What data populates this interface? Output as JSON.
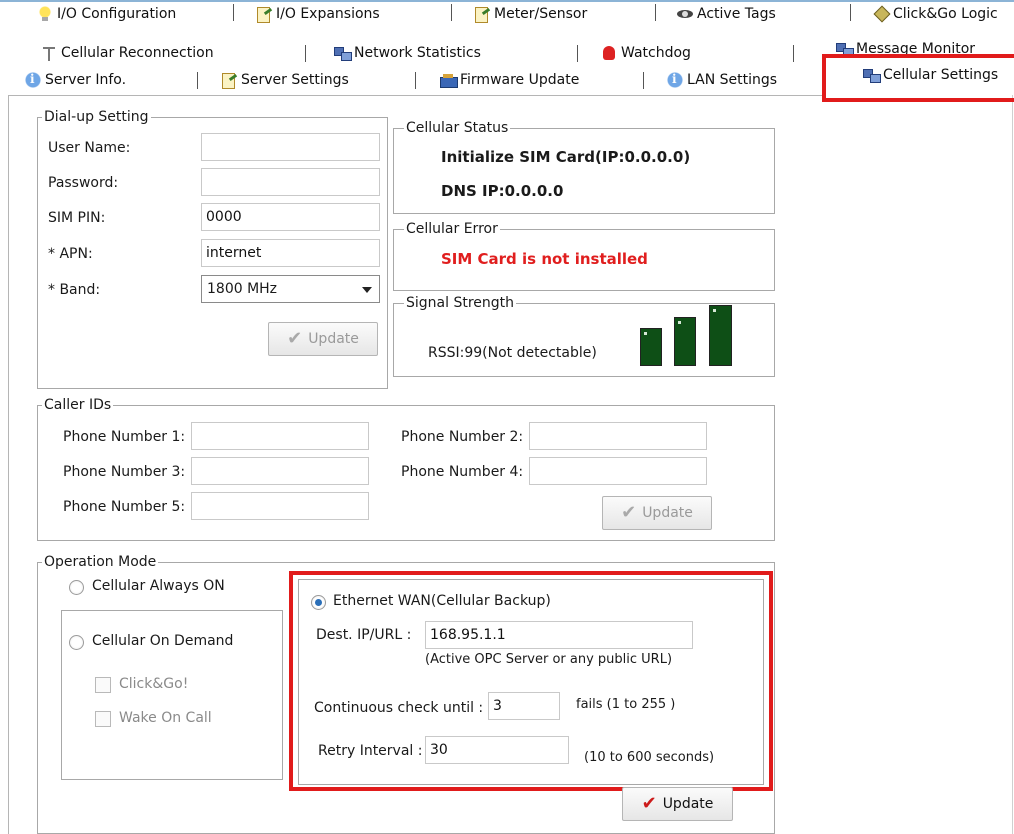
{
  "tabs": {
    "row1": [
      {
        "label": "I/O Configuration",
        "icon": "lightbulb-icon"
      },
      {
        "label": "I/O Expansions",
        "icon": "io-expansion-icon"
      },
      {
        "label": "Meter/Sensor",
        "icon": "meter-sensor-icon"
      },
      {
        "label": "Active Tags",
        "icon": "active-tags-icon"
      },
      {
        "label": "Click&Go Logic",
        "icon": "click-go-icon"
      }
    ],
    "row2": [
      {
        "label": "Cellular Reconnection",
        "icon": "antenna-icon"
      },
      {
        "label": "Network Statistics",
        "icon": "network-icon"
      },
      {
        "label": "Watchdog",
        "icon": "watchdog-icon"
      },
      {
        "label": "Message Monitor",
        "icon": "message-monitor-icon"
      }
    ],
    "row3": [
      {
        "label": "Server Info.",
        "icon": "info-icon"
      },
      {
        "label": "Server Settings",
        "icon": "server-settings-icon"
      },
      {
        "label": "Firmware Update",
        "icon": "firmware-icon"
      },
      {
        "label": "LAN Settings",
        "icon": "info-icon"
      },
      {
        "label": "Cellular Settings",
        "icon": "network-icon",
        "active": true
      }
    ]
  },
  "dialup": {
    "title": "Dial-up Setting",
    "user_name_label": "User Name:",
    "user_name_value": "",
    "password_label": "Password:",
    "password_value": "",
    "sim_pin_label": "SIM PIN:",
    "sim_pin_value": "0000",
    "apn_label": "* APN:",
    "apn_value": "internet",
    "band_label": "* Band:",
    "band_value": "1800 MHz",
    "update_label": "Update"
  },
  "cellular_status": {
    "title": "Cellular Status",
    "line1": "Initialize SIM Card(IP:0.0.0.0)",
    "line2": "DNS IP:0.0.0.0"
  },
  "cellular_error": {
    "title": "Cellular Error",
    "message": "SIM Card is not installed",
    "color": "#e01e1e"
  },
  "signal": {
    "title": "Signal Strength",
    "rssi_text": "RSSI:99(Not detectable)",
    "bar_color": "#0e4f16"
  },
  "caller_ids": {
    "title": "Caller IDs",
    "phone1_label": "Phone Number 1:",
    "phone2_label": "Phone Number 2:",
    "phone3_label": "Phone Number 3:",
    "phone4_label": "Phone Number 4:",
    "phone5_label": "Phone Number 5:",
    "phone1_value": "",
    "phone2_value": "",
    "phone3_value": "",
    "phone4_value": "",
    "phone5_value": "",
    "update_label": "Update"
  },
  "operation_mode": {
    "title": "Operation Mode",
    "always_on_label": "Cellular Always ON",
    "on_demand_label": "Cellular On Demand",
    "clickgo_label": "Click&Go!",
    "wake_on_call_label": "Wake On Call",
    "ethernet_wan_label": "Ethernet WAN(Cellular Backup)",
    "dest_label": "Dest. IP/URL :",
    "dest_value": "168.95.1.1",
    "dest_hint": "(Active OPC Server or any public URL)",
    "continuous_label": "Continuous check until :",
    "continuous_value": "3",
    "continuous_hint": "fails (1 to 255 )",
    "retry_label": "Retry Interval :",
    "retry_value": "30",
    "retry_hint": "(10 to 600 seconds)",
    "update_label": "Update",
    "selected": "ethernet_wan"
  },
  "highlight_color": "#e11b1b"
}
